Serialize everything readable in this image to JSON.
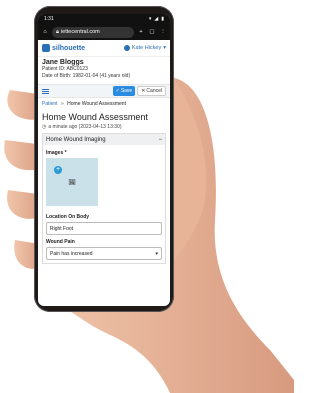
{
  "status": {
    "time": "1:31"
  },
  "browser": {
    "url": "iettecentral.com"
  },
  "app": {
    "brand": "silhouette",
    "user": "Kate Hickey"
  },
  "patient": {
    "name": "Jane Bloggs",
    "id_line": "Patient ID: ABC0123",
    "dob_line": "Date of Birth: 1982-01-04 (41 years old)"
  },
  "toolbar": {
    "save_label": "Save",
    "cancel_label": "Cancel"
  },
  "breadcrumb": {
    "root": "Patient",
    "sep": "»",
    "current": "Home Wound Assessment"
  },
  "page": {
    "title": "Home Wound Assessment",
    "timestamp": "a minute ago (2023-04-13 13:30)"
  },
  "section": {
    "title": "Home Wound Imaging",
    "images_label": "Images *",
    "location_label": "Location On Body",
    "location_value": "Right Foot",
    "pain_label": "Wound Pain",
    "pain_value": "Pain has increased"
  },
  "colors": {
    "accent": "#2b6fb5",
    "save": "#2b8be0",
    "image_bg": "#cbe1ea"
  }
}
